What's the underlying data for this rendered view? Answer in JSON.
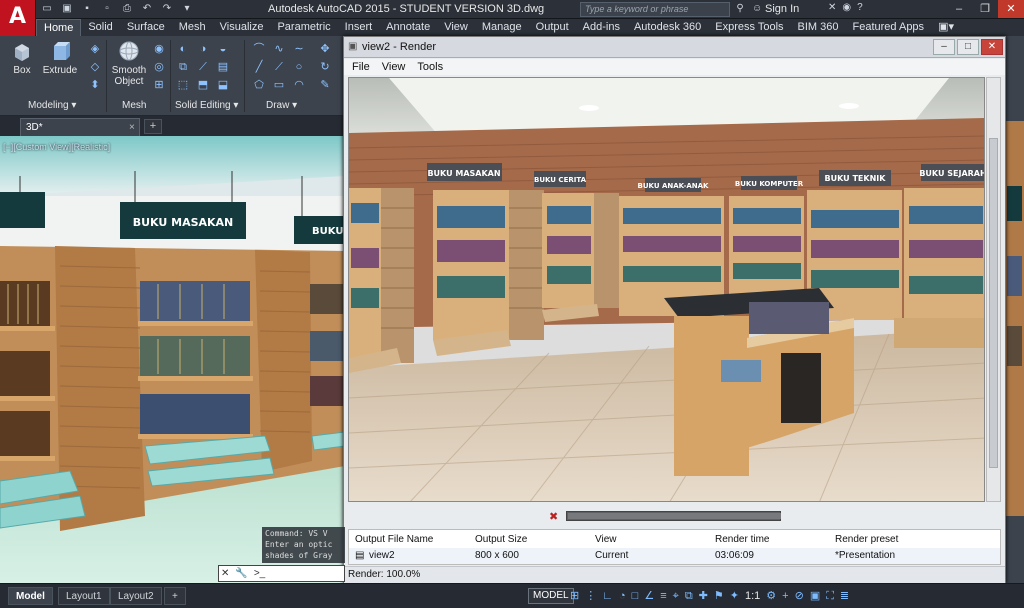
{
  "app": {
    "logo": "A",
    "title": "Autodesk AutoCAD 2015 - STUDENT VERSION    3D.dwg",
    "search_placeholder": "Type a keyword or phrase",
    "signin": "Sign In"
  },
  "ribbon": {
    "tabs": [
      "Home",
      "Solid",
      "Surface",
      "Mesh",
      "Visualize",
      "Parametric",
      "Insert",
      "Annotate",
      "View",
      "Manage",
      "Output",
      "Add-ins",
      "Autodesk 360",
      "Express Tools",
      "BIM 360",
      "Featured Apps"
    ],
    "active_tab": "Home",
    "buttons": {
      "box": "Box",
      "extrude": "Extrude",
      "smooth_object_1": "Smooth",
      "smooth_object_2": "Object"
    },
    "panels": {
      "modeling": "Modeling ▾",
      "mesh": "Mesh",
      "solid_editing": "Solid Editing ▾",
      "draw": "Draw ▾"
    }
  },
  "doc": {
    "tab_label": "3D*",
    "close": "×",
    "new_tab": "+"
  },
  "viewport": {
    "label": "[−][Custom View][Realistic]",
    "signs": [
      "BUKU MASAKAN",
      "BUKU"
    ],
    "command_history": [
      "Command: VS V",
      "Enter an optic",
      "shades of Gray"
    ],
    "command_prompt": ">_"
  },
  "render_window": {
    "title": "view2 - Render",
    "menu": [
      "File",
      "View",
      "Tools"
    ],
    "signs": [
      "BUKU MASAKAN",
      "BUKU CERITA",
      "BUKU ANAK-ANAK",
      "BUKU KOMPUTER",
      "BUKU TEKNIK",
      "BUKU SEJARAH"
    ],
    "progress": 1.0,
    "history_headers": [
      "Output File Name",
      "Output Size",
      "View",
      "Render time",
      "Render preset"
    ],
    "history_row": [
      "view2",
      "800 x 600",
      "Current",
      "03:06:09",
      "*Presentation"
    ],
    "status": "Render: 100.0%"
  },
  "statusbar": {
    "layout_tabs": [
      "Model",
      "Layout1",
      "Layout2"
    ],
    "add_tab": "+",
    "model_button": "MODEL",
    "scale": "1:1"
  },
  "colors": {
    "accent": "#c1121f",
    "ribbon_bg": "#3c434d",
    "app_bg": "#2b3039",
    "wood": "#b7824d",
    "sign": "#143a3d"
  }
}
